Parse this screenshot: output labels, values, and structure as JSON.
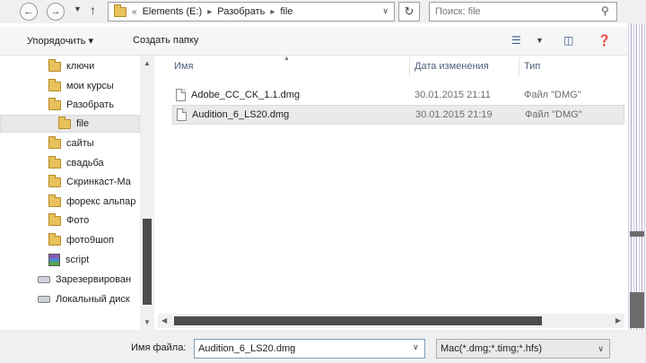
{
  "address_bar": {
    "overflow_label": "«",
    "path": [
      "Elements (E:)",
      "Разобрать",
      "file"
    ],
    "search_placeholder": "Поиск: file"
  },
  "toolbar": {
    "organize_label": "Упорядочить ▾",
    "new_folder_label": "Создать папку"
  },
  "nav_pane": {
    "items": [
      {
        "label": "ключи",
        "icon": "folder-icon",
        "indent": 1
      },
      {
        "label": "мои курсы",
        "icon": "folder-icon",
        "indent": 1
      },
      {
        "label": "Разобрать",
        "icon": "folder-icon",
        "indent": 1
      },
      {
        "label": "file",
        "icon": "folder-icon",
        "indent": 2,
        "selected": true
      },
      {
        "label": "сайты",
        "icon": "folder-icon",
        "indent": 1
      },
      {
        "label": "свадьба",
        "icon": "folder-icon",
        "indent": 1
      },
      {
        "label": "Скринкаст-Ма",
        "icon": "folder-icon",
        "indent": 1
      },
      {
        "label": "форекс альпар",
        "icon": "folder-icon",
        "indent": 1
      },
      {
        "label": "Фото",
        "icon": "folder-icon",
        "indent": 1
      },
      {
        "label": "фото9шоп",
        "icon": "folder-icon",
        "indent": 1
      },
      {
        "label": "script",
        "icon": "rar-archive-icon",
        "indent": 1
      },
      {
        "label": "Зарезервирован",
        "icon": "drive-icon",
        "indent": 0
      },
      {
        "label": "Локальный диск",
        "icon": "drive-icon",
        "indent": 0
      }
    ]
  },
  "file_list": {
    "columns": {
      "name": "Имя",
      "date": "Дата изменения",
      "type": "Тип"
    },
    "rows": [
      {
        "name": "Adobe_CC_CK_1.1.dmg",
        "date": "30.01.2015 21:11",
        "type": "Файл \"DMG\"",
        "selected": false
      },
      {
        "name": "Audition_6_LS20.dmg",
        "date": "30.01.2015 21:19",
        "type": "Файл \"DMG\"",
        "selected": true
      }
    ]
  },
  "bottom": {
    "file_name_label": "Имя файла:",
    "file_name_value": "Audition_6_LS20.dmg",
    "file_type_value": "Mac(*.dmg;*.timg;*.hfs)"
  },
  "colors": {
    "folder": "#e8c15a",
    "header_text": "#4c607a",
    "scroll_thumb": "#4d4d4d"
  }
}
